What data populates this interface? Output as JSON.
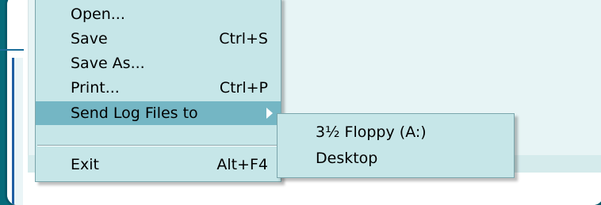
{
  "menu": {
    "items": [
      {
        "label": "Open...",
        "shortcut": ""
      },
      {
        "label": "Save",
        "shortcut": "Ctrl+S"
      },
      {
        "label": "Save As...",
        "shortcut": ""
      },
      {
        "label": "Print...",
        "shortcut": "Ctrl+P"
      },
      {
        "label": "Send Log Files to",
        "shortcut": "",
        "submenu": true,
        "highlighted": true
      },
      {
        "label": "Exit",
        "shortcut": "Alt+F4"
      }
    ]
  },
  "submenu": {
    "items": [
      {
        "label": "3½ Floppy (A:)"
      },
      {
        "label": "Desktop"
      }
    ]
  },
  "colors": {
    "menu_bg": "#c6e6e8",
    "highlight": "#74b6c4",
    "frame": "#05596a"
  }
}
